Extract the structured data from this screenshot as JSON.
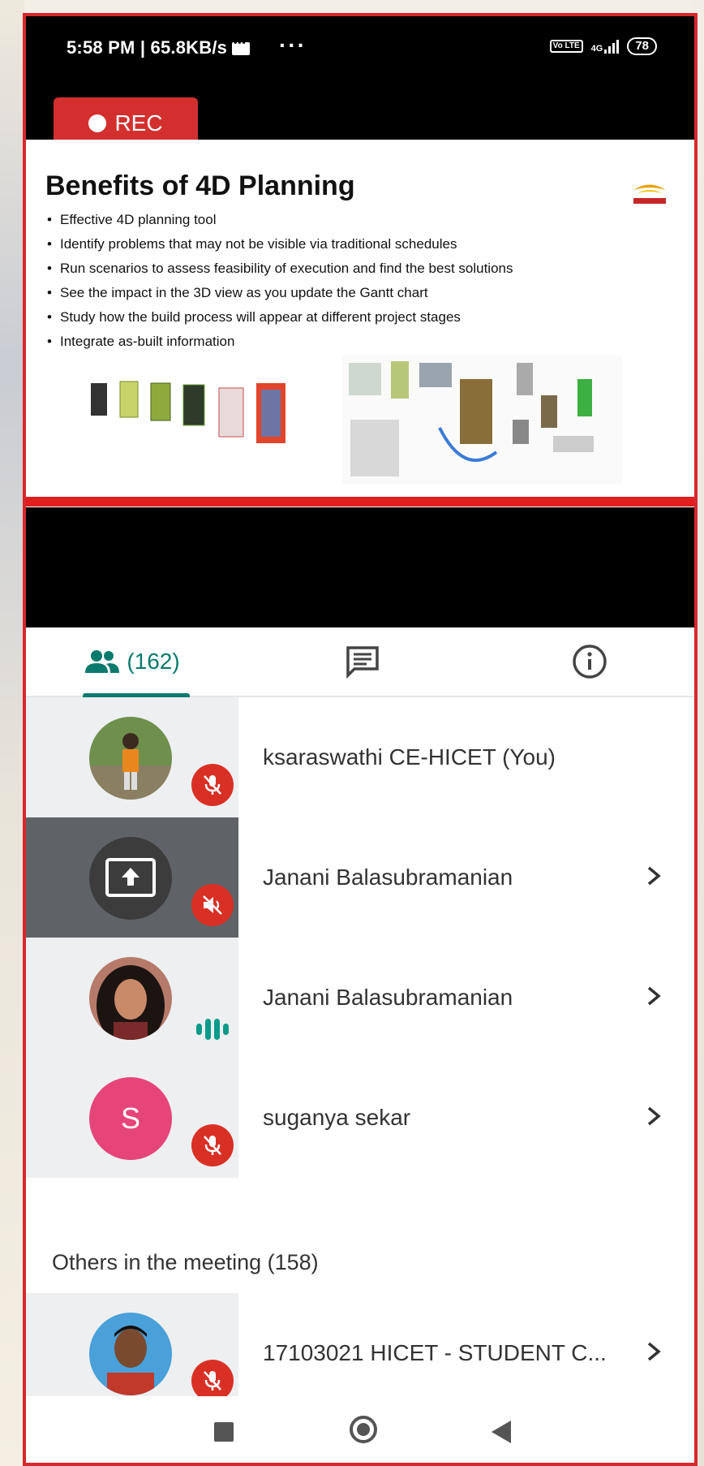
{
  "status_bar": {
    "time_speed": "5:58 PM | 65.8KB/s",
    "overflow": "···",
    "volte": "Vo LTE",
    "network": "4G",
    "battery": "78"
  },
  "recording": {
    "label": "REC"
  },
  "slide": {
    "title": "Benefits of 4D Planning",
    "bullets": [
      "Effective 4D planning tool",
      "Identify problems that may not be visible via traditional schedules",
      "Run scenarios to assess feasibility of execution and find the best solutions",
      "See the impact in the 3D view as you update the Gantt chart",
      "Study how the build process will appear at different project stages",
      "Integrate as-built information"
    ]
  },
  "tabs": {
    "people_count": "(162)"
  },
  "participants": [
    {
      "name": "ksaraswathi CE-HICET (You)"
    },
    {
      "name": "Janani Balasubramanian"
    },
    {
      "name": "Janani Balasubramanian"
    },
    {
      "name": "suganya sekar",
      "initial": "S"
    }
  ],
  "others": {
    "label": "Others in the meeting (158)",
    "items": [
      {
        "name": "17103021 HICET - STUDENT C..."
      }
    ]
  },
  "colors": {
    "accent": "#0b7a6e",
    "mute_red": "#d93025",
    "rec_red": "#d32f2f",
    "avatar_pink": "#e6457a"
  }
}
